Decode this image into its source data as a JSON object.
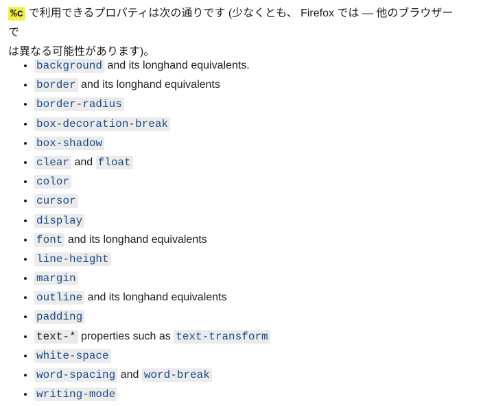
{
  "intro": {
    "highlight": "%c",
    "text_line1": " で利用できるプロパティは次の通りです (少なくとも、 Firefox では — 他のブラウザーで",
    "text_line2": "は異なる可能性があります)。"
  },
  "items": [
    {
      "code1": "background",
      "text": " and its longhand equivalents."
    },
    {
      "code1": "border",
      "text": " and its longhand equivalents"
    },
    {
      "code1": "border-radius"
    },
    {
      "code1": "box-decoration-break"
    },
    {
      "code1": "box-shadow"
    },
    {
      "code1": "clear",
      "text": " and ",
      "code2": "float"
    },
    {
      "code1": "color"
    },
    {
      "code1": "cursor"
    },
    {
      "code1": "display"
    },
    {
      "code1": "font",
      "text": " and its longhand equivalents"
    },
    {
      "code1": "line-height"
    },
    {
      "code1": "margin"
    },
    {
      "code1": "outline",
      "text": " and its longhand equivalents"
    },
    {
      "code1": "padding"
    },
    {
      "code1": "text-*",
      "text": " properties such as ",
      "code2": "text-transform"
    },
    {
      "code1": "white-space"
    },
    {
      "code1": "word-spacing",
      "text": " and ",
      "code2": "word-break"
    },
    {
      "code1": "writing-mode"
    }
  ]
}
